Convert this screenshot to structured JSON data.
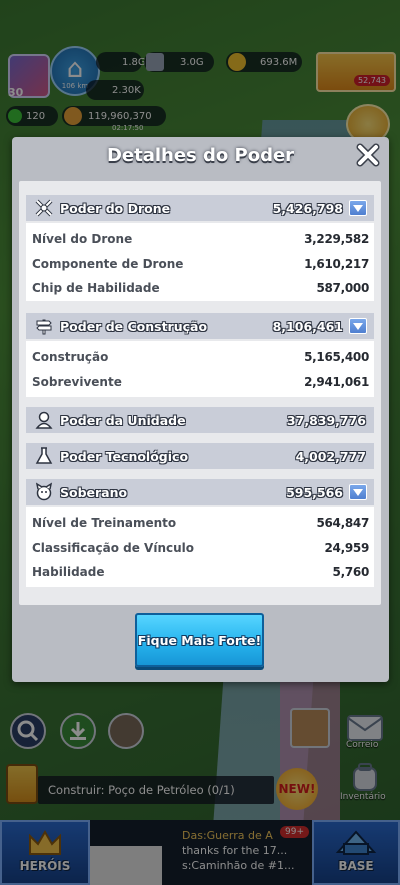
{
  "hud": {
    "res1": "1.8G",
    "res2": "3.0G",
    "res3": "693.6M",
    "res4": "2.30K",
    "level": "30",
    "home_distance": "106 km",
    "energy": "120",
    "power_total": "119,960,370",
    "timer": "02:17:50",
    "shop_count": "52,743"
  },
  "modal": {
    "title": "Detalhes do Poder",
    "sections": [
      {
        "label": "Poder do Drone",
        "value": "5,426,798",
        "icon": "drone-icon",
        "expandable": true,
        "rows": [
          {
            "label": "Nível do Drone",
            "value": "3,229,582"
          },
          {
            "label": "Componente de Drone",
            "value": "1,610,217"
          },
          {
            "label": "Chip de Habilidade",
            "value": "587,000"
          }
        ]
      },
      {
        "label": "Poder de Construção",
        "value": "8,106,461",
        "icon": "signpost-icon",
        "expandable": true,
        "rows": [
          {
            "label": "Construção",
            "value": "5,165,400"
          },
          {
            "label": "Sobrevivente",
            "value": "2,941,061"
          }
        ]
      },
      {
        "label": "Poder da Unidade",
        "value": "37,839,776",
        "icon": "person-icon",
        "expandable": false
      },
      {
        "label": "Poder Tecnológico",
        "value": "4,002,777",
        "icon": "flask-icon",
        "expandable": false
      },
      {
        "label": "Soberano",
        "value": "595,566",
        "icon": "dog-icon",
        "expandable": true,
        "rows": [
          {
            "label": "Nível de Treinamento",
            "value": "564,847"
          },
          {
            "label": "Classificação de Vínculo",
            "value": "24,959"
          },
          {
            "label": "Habilidade",
            "value": "5,760"
          }
        ]
      }
    ],
    "button_label": "Fique Mais Forte!"
  },
  "bottom": {
    "build_text": "Construir: Poço de Petróleo (0/1)",
    "new_badge": "NEW!",
    "mail_label": "Correio",
    "inventory_label": "Inventário",
    "heroes_label": "HERÓIS",
    "base_label": "BASE",
    "chat_badge": "99+",
    "chat_line1": "Das:Guerra de A",
    "chat_line2": "thanks for the 17...",
    "chat_line3": "s:Caminhão de #1..."
  },
  "colors": {
    "section_header": "#c9cdd8",
    "button": "#27b4ee",
    "modal_bg": "#b9bcc3"
  }
}
